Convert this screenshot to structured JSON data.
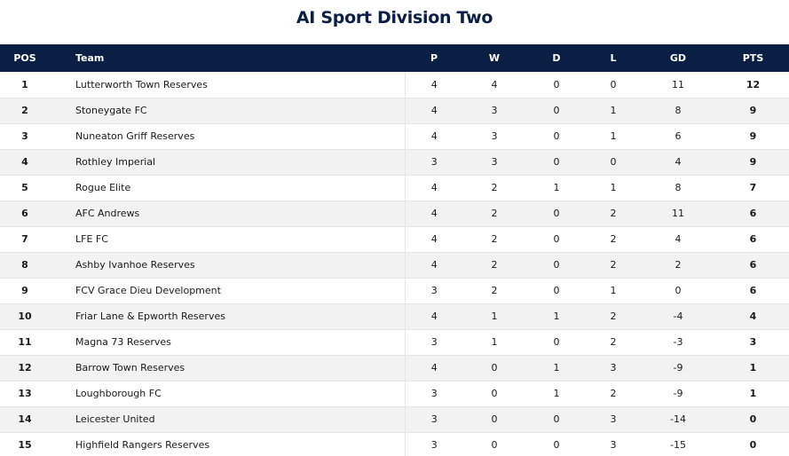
{
  "title": "AI Sport Division Two",
  "columns": {
    "pos": "POS",
    "team": "Team",
    "p": "P",
    "w": "W",
    "d": "D",
    "l": "L",
    "gd": "GD",
    "pts": "PTS"
  },
  "rows": [
    {
      "pos": "1",
      "team": "Lutterworth Town Reserves",
      "p": "4",
      "w": "4",
      "d": "0",
      "l": "0",
      "gd": "11",
      "pts": "12"
    },
    {
      "pos": "2",
      "team": "Stoneygate FC",
      "p": "4",
      "w": "3",
      "d": "0",
      "l": "1",
      "gd": "8",
      "pts": "9"
    },
    {
      "pos": "3",
      "team": "Nuneaton Griff Reserves",
      "p": "4",
      "w": "3",
      "d": "0",
      "l": "1",
      "gd": "6",
      "pts": "9"
    },
    {
      "pos": "4",
      "team": "Rothley Imperial",
      "p": "3",
      "w": "3",
      "d": "0",
      "l": "0",
      "gd": "4",
      "pts": "9"
    },
    {
      "pos": "5",
      "team": "Rogue Elite",
      "p": "4",
      "w": "2",
      "d": "1",
      "l": "1",
      "gd": "8",
      "pts": "7"
    },
    {
      "pos": "6",
      "team": "AFC Andrews",
      "p": "4",
      "w": "2",
      "d": "0",
      "l": "2",
      "gd": "11",
      "pts": "6"
    },
    {
      "pos": "7",
      "team": "LFE FC",
      "p": "4",
      "w": "2",
      "d": "0",
      "l": "2",
      "gd": "4",
      "pts": "6"
    },
    {
      "pos": "8",
      "team": "Ashby Ivanhoe Reserves",
      "p": "4",
      "w": "2",
      "d": "0",
      "l": "2",
      "gd": "2",
      "pts": "6"
    },
    {
      "pos": "9",
      "team": "FCV Grace Dieu Development",
      "p": "3",
      "w": "2",
      "d": "0",
      "l": "1",
      "gd": "0",
      "pts": "6"
    },
    {
      "pos": "10",
      "team": "Friar Lane & Epworth Reserves",
      "p": "4",
      "w": "1",
      "d": "1",
      "l": "2",
      "gd": "-4",
      "pts": "4"
    },
    {
      "pos": "11",
      "team": "Magna 73 Reserves",
      "p": "3",
      "w": "1",
      "d": "0",
      "l": "2",
      "gd": "-3",
      "pts": "3"
    },
    {
      "pos": "12",
      "team": "Barrow Town Reserves",
      "p": "4",
      "w": "0",
      "d": "1",
      "l": "3",
      "gd": "-9",
      "pts": "1"
    },
    {
      "pos": "13",
      "team": "Loughborough FC",
      "p": "3",
      "w": "0",
      "d": "1",
      "l": "2",
      "gd": "-9",
      "pts": "1"
    },
    {
      "pos": "14",
      "team": "Leicester United",
      "p": "3",
      "w": "0",
      "d": "0",
      "l": "3",
      "gd": "-14",
      "pts": "0"
    },
    {
      "pos": "15",
      "team": "Highfield Rangers Reserves",
      "p": "3",
      "w": "0",
      "d": "0",
      "l": "3",
      "gd": "-15",
      "pts": "0"
    }
  ],
  "colors": {
    "header_bg": "#0b1f45",
    "title": "#0b1f45",
    "row_alt": "#f2f2f2"
  }
}
